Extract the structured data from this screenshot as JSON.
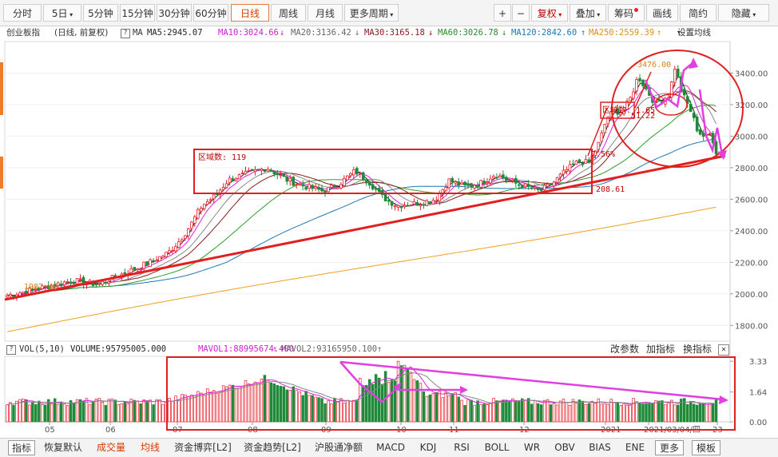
{
  "toolbar": {
    "periods": [
      {
        "label": "分时",
        "active": false
      },
      {
        "label": "5日",
        "active": false,
        "dropdown": true
      },
      {
        "label": "5分钟",
        "active": false
      },
      {
        "label": "15分钟",
        "active": false
      },
      {
        "label": "30分钟",
        "active": false
      },
      {
        "label": "60分钟",
        "active": false
      },
      {
        "label": "日线",
        "active": true
      },
      {
        "label": "周线",
        "active": false
      },
      {
        "label": "月线",
        "active": false
      },
      {
        "label": "更多周期",
        "active": false,
        "dropdown": true
      }
    ],
    "zoom_in": "+",
    "zoom_out": "−",
    "adjust": "复权",
    "overlay": "叠加",
    "chips": "筹码",
    "draw": "画线",
    "simple": "简约",
    "hide": "隐藏"
  },
  "info": {
    "name": "创业板指",
    "mode": "(日线, 前复权)",
    "ma_label": "MA",
    "ma5": "MA5:2945.07",
    "ma10": "MA10:3024.66",
    "ma20": "MA20:3136.42",
    "ma30": "MA30:3165.18",
    "ma60": "MA60:3026.78",
    "ma120": "MA120:2842.60",
    "ma250": "MA250:2559.39",
    "settings": "设置均线"
  },
  "colors": {
    "up": "#e5202a",
    "down": "#1f8a3a",
    "ma5": "#222222",
    "ma10": "#e020e0",
    "ma20": "#888888",
    "ma30": "#8b1a1a",
    "ma60": "#2ca02c",
    "ma120": "#1f77b4",
    "ma250": "#f0a020",
    "annotation": "#e02020",
    "arrow": "#e040e0"
  },
  "chart_data": {
    "type": "candlestick",
    "y_axis": {
      "ticks": [
        "3400.00",
        "3200.00",
        "3000.00",
        "2800.00",
        "2600.00",
        "2400.00",
        "2200.00",
        "2000.00",
        "1800.00"
      ],
      "range": [
        1700,
        3600
      ]
    },
    "x_axis": {
      "ticks": [
        "05",
        "06",
        "07",
        "08",
        "09",
        "10",
        "11",
        "12",
        "2021",
        "2021/03/04/四",
        "23"
      ]
    },
    "annotations": [
      "1987.40",
      "区域数: 119",
      "208.61",
      "7.56%",
      "3476.00",
      "区域数: 1.65",
      "51.22"
    ],
    "volume": {
      "label": "VOL(5,10)",
      "volume": "VOLUME:95795005.000",
      "mavol1": "MAVOL1:88995674.400",
      "mavol2": "MAVOL2:93165950.100",
      "y_ticks": [
        "3.33",
        "1.64",
        "0.00"
      ]
    }
  },
  "volume_tools": {
    "edit_params": "改参数",
    "add_indicator": "加指标",
    "change_indicator": "换指标"
  },
  "tabs": [
    {
      "label": "指标",
      "active": false
    },
    {
      "label": "恢复默认",
      "active": false
    },
    {
      "label": "成交量",
      "active": true
    },
    {
      "label": "均线",
      "active": true
    },
    {
      "label": "资金博弈[L2]",
      "active": false
    },
    {
      "label": "资金趋势[L2]",
      "active": false
    },
    {
      "label": "沪股通净额",
      "active": false
    },
    {
      "label": "MACD",
      "active": false
    },
    {
      "label": "KDJ",
      "active": false
    },
    {
      "label": "RSI",
      "active": false
    },
    {
      "label": "BOLL",
      "active": false
    },
    {
      "label": "WR",
      "active": false
    },
    {
      "label": "OBV",
      "active": false
    },
    {
      "label": "BIAS",
      "active": false
    },
    {
      "label": "ENE",
      "active": false
    },
    {
      "label": "更多",
      "active": false
    },
    {
      "label": "模板",
      "active": false
    }
  ]
}
